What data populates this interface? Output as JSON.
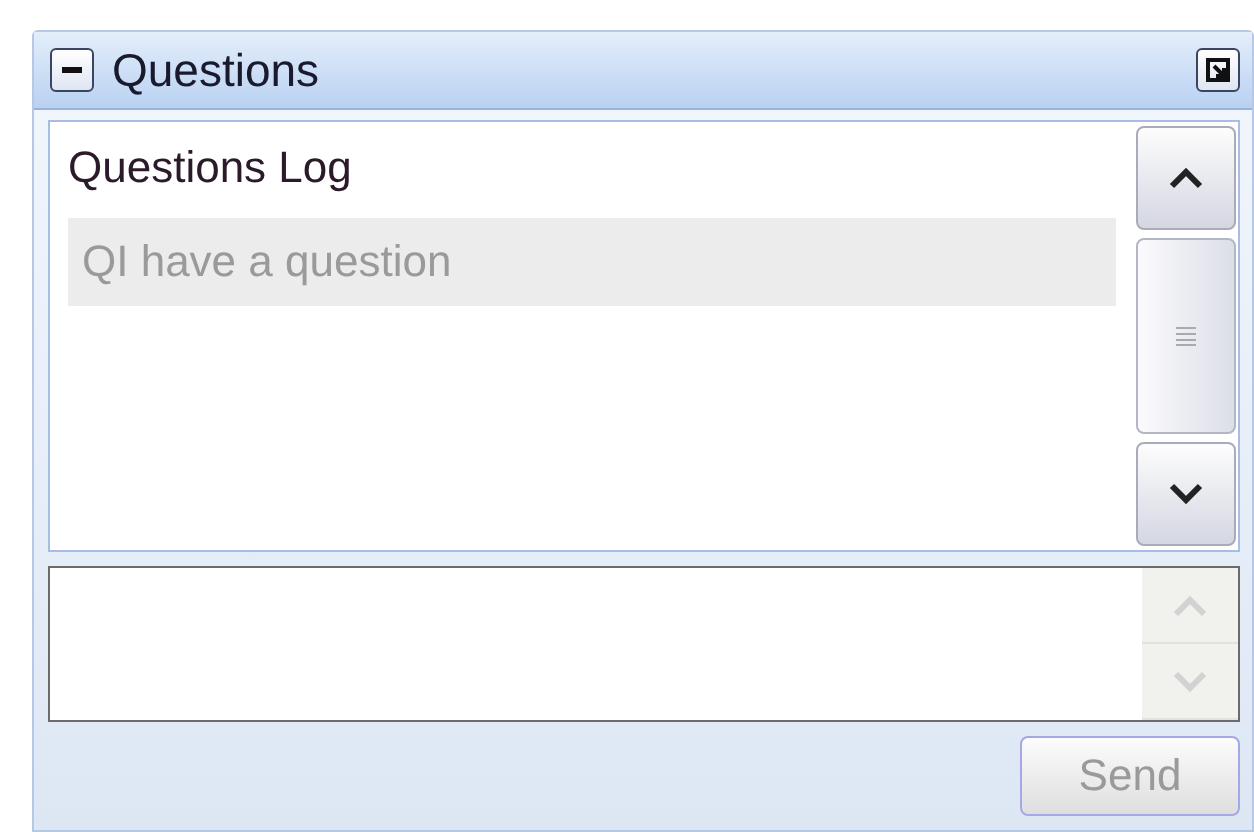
{
  "panel": {
    "title": "Questions",
    "expanded": true
  },
  "log": {
    "heading": "Questions Log",
    "items": [
      {
        "text": "QI have a question"
      }
    ]
  },
  "send": {
    "label": "Send",
    "disabled": true
  }
}
